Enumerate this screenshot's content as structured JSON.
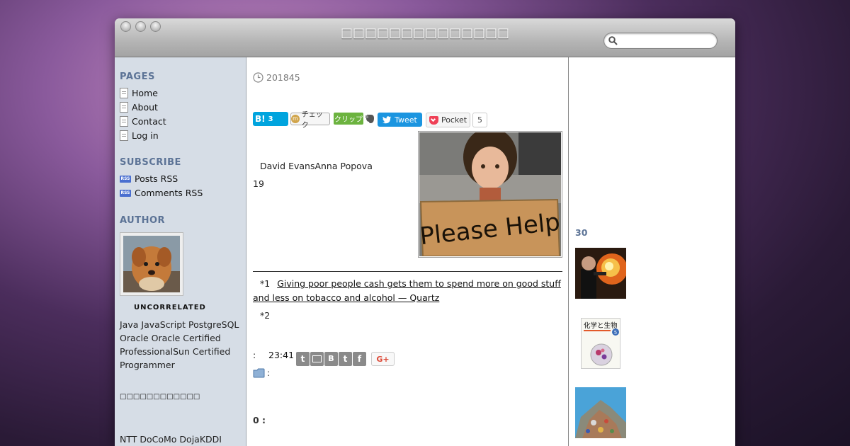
{
  "window": {
    "title": "□□□□□□□□□□□□□□"
  },
  "search": {
    "placeholder": ""
  },
  "sidebar": {
    "pages_heading": "PAGES",
    "pages": [
      "Home",
      "About",
      "Contact",
      "Log in"
    ],
    "subscribe_heading": "SUBSCRIBE",
    "subscribe": [
      "Posts RSS",
      "Comments RSS"
    ],
    "author_heading": "AUTHOR",
    "author_name": "UNCORRELATED",
    "author_bio": "Java JavaScript PostgreSQL Oracle Oracle Certified ProfessionalSun Certified Programmer",
    "garbled": "□□□□□□□□□□□□",
    "bottom_text": "NTT DoCoMo DojaKDDI"
  },
  "post": {
    "date": "201845",
    "hatena_label": "B!",
    "hatena_count": "3",
    "check_label": "チェック",
    "clip_label": "クリップ",
    "tweet_label": "Tweet",
    "pocket_label": "Pocket",
    "pocket_count": "5",
    "names": "David EvansAnna Popova",
    "number": "19",
    "image_text": "Please Help",
    "footnote1_marker": "*1",
    "footnote1_link": "Giving poor people cash gets them to spend more on good stuff and less on tobacco and alcohol — Quartz",
    "footnote2_marker": "*2",
    "time_prefix": ":",
    "time": "23:41",
    "gplus_label": "G+",
    "category_sep": ":",
    "comments": "0 :"
  },
  "right": {
    "heading": "30",
    "thumb2_title": "化学と生物",
    "thumb2_issue": "5"
  },
  "colors": {
    "sidebar_bg": "#d6dde6",
    "heading": "#5c7396",
    "hatena": "#00a4de",
    "tweet": "#1b95e0",
    "pocket": "#ef4056",
    "clip": "#6cb33f"
  }
}
